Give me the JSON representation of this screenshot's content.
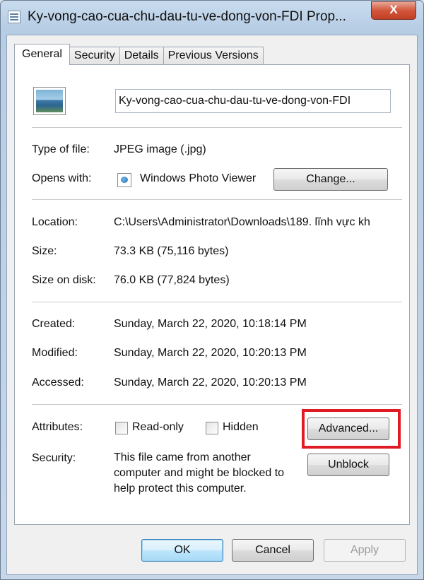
{
  "window": {
    "title": "Ky-vong-cao-cua-chu-dau-tu-ve-dong-von-FDI Prop...",
    "close_label": "X"
  },
  "tabs": [
    {
      "label": "General",
      "active": true
    },
    {
      "label": "Security",
      "active": false
    },
    {
      "label": "Details",
      "active": false
    },
    {
      "label": "Previous Versions",
      "active": false
    }
  ],
  "file": {
    "name": "Ky-vong-cao-cua-chu-dau-tu-ve-dong-von-FDI",
    "icon": "jpeg-image-icon"
  },
  "type": {
    "label": "Type of file:",
    "value": "JPEG image (.jpg)"
  },
  "opens_with": {
    "label": "Opens with:",
    "app_icon": "photo-viewer-icon",
    "value": "Windows Photo Viewer",
    "change_button": "Change..."
  },
  "location": {
    "label": "Location:",
    "value": "C:\\Users\\Administrator\\Downloads\\189. lĩnh vực kh"
  },
  "size": {
    "label": "Size:",
    "value": "73.3 KB (75,116 bytes)"
  },
  "size_on_disk": {
    "label": "Size on disk:",
    "value": "76.0 KB (77,824 bytes)"
  },
  "created": {
    "label": "Created:",
    "value": "Sunday, March 22, 2020, 10:18:14 PM"
  },
  "modified": {
    "label": "Modified:",
    "value": "Sunday, March 22, 2020, 10:20:13 PM"
  },
  "accessed": {
    "label": "Accessed:",
    "value": "Sunday, March 22, 2020, 10:20:13 PM"
  },
  "attributes": {
    "label": "Attributes:",
    "readonly_label": "Read-only",
    "readonly_checked": false,
    "hidden_label": "Hidden",
    "hidden_checked": false,
    "advanced_button": "Advanced..."
  },
  "security": {
    "label": "Security:",
    "line1": "This file came from another",
    "line2": "computer and might be blocked to",
    "line3": "help protect this computer.",
    "unblock_button": "Unblock"
  },
  "footer": {
    "ok": "OK",
    "cancel": "Cancel",
    "apply": "Apply"
  },
  "colors": {
    "highlight": "#e01b24",
    "close_button": "#c23f24"
  }
}
